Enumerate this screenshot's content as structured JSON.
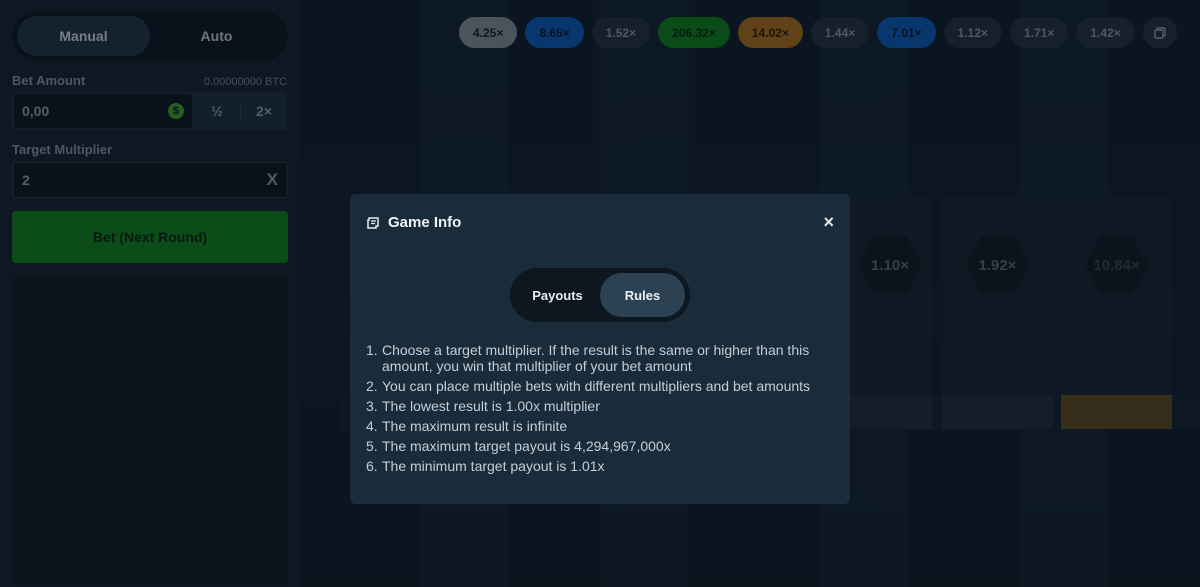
{
  "sidebar": {
    "mode_tabs": [
      {
        "label": "Manual",
        "active": true
      },
      {
        "label": "Auto",
        "active": false
      }
    ],
    "bet_amount": {
      "label": "Bet Amount",
      "balance": "0.00000000 BTC",
      "value": "0,00",
      "currency_icon": "dollar-coin-icon",
      "half_label": "½",
      "double_label": "2×"
    },
    "target_multiplier": {
      "label": "Target Multiplier",
      "value": "2",
      "clear_label": "X"
    },
    "bet_button_label": "Bet (Next Round)"
  },
  "history": [
    {
      "value": "4.25×",
      "color": "light"
    },
    {
      "value": "8.65×",
      "color": "blue"
    },
    {
      "value": "1.52×",
      "color": "grey"
    },
    {
      "value": "206.32×",
      "color": "green"
    },
    {
      "value": "14.02×",
      "color": "orange"
    },
    {
      "value": "1.44×",
      "color": "grey"
    },
    {
      "value": "7.01×",
      "color": "blue"
    },
    {
      "value": "1.12×",
      "color": "grey"
    },
    {
      "value": "1.71×",
      "color": "grey"
    },
    {
      "value": "1.42×",
      "color": "grey"
    }
  ],
  "history_icon": "history-icon",
  "cards": [
    {
      "label": "1.10×"
    },
    {
      "label": "1.92×"
    },
    {
      "label": "10.84×"
    }
  ],
  "modal": {
    "title": "Game Info",
    "title_icon": "game-info-icon",
    "close_label": "×",
    "tabs": [
      {
        "label": "Payouts",
        "active": false
      },
      {
        "label": "Rules",
        "active": true
      }
    ],
    "rules": [
      {
        "num": "1.",
        "text": "Choose a target multiplier. If the result is the same or higher than this amount, you win that multiplier of your bet amount"
      },
      {
        "num": "2.",
        "text": "You can place multiple bets with different multipliers and bet amounts"
      },
      {
        "num": "3.",
        "text": "The lowest result is 1.00x multiplier"
      },
      {
        "num": "4.",
        "text": "The maximum result is infinite"
      },
      {
        "num": "5.",
        "text": "The maximum target payout is 4,294,967,000x"
      },
      {
        "num": "6.",
        "text": "The minimum target payout is 1.01x"
      }
    ]
  },
  "colors": {
    "bet_button": "#0e7b1e",
    "chip_blue": "#0a56b2",
    "chip_green": "#0d7a1c",
    "chip_orange": "#a0681d"
  }
}
